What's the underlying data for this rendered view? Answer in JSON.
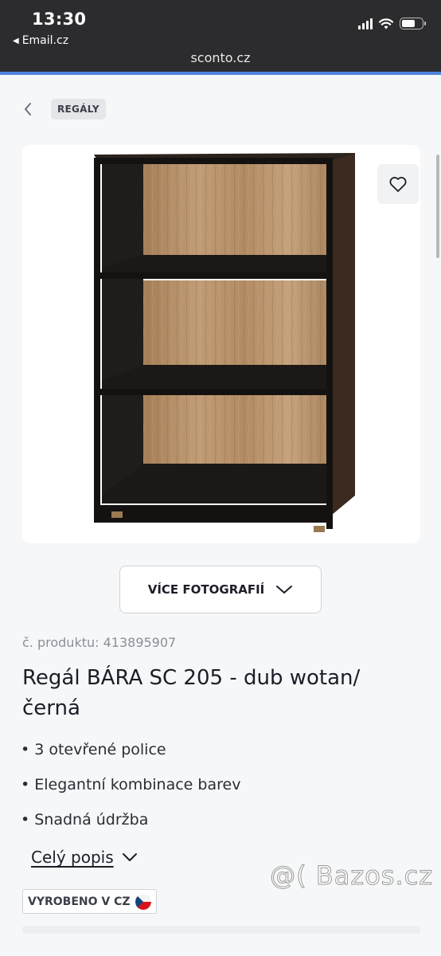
{
  "status_bar": {
    "time": "13:30",
    "back_app": "Email.cz"
  },
  "browser": {
    "url": "sconto.cz"
  },
  "breadcrumb": {
    "category": "REGÁLY"
  },
  "product": {
    "more_photos_label": "VÍCE FOTOGRAFIÍ",
    "sku": "č. produktu: 413895907",
    "title": "Regál BÁRA SC 205 - dub wotan/ černá",
    "features": [
      "3 otevřené police",
      "Elegantní kombinace barev",
      "Snadná údržba"
    ],
    "full_description_link": "Celý popis",
    "made_in_badge": "VYROBENO V CZ"
  },
  "watermark": "@( Bazos.cz",
  "colors": {
    "accent_line": "#2e6fd8",
    "wood": "#b38d66",
    "dark_frame": "#1c1a18",
    "text": "#1d1d28",
    "muted": "#8a8f98"
  },
  "icons": [
    "signal-icon",
    "wifi-icon",
    "battery-icon",
    "chevron-left-icon",
    "heart-icon",
    "chevron-down-icon",
    "czech-flag-icon"
  ]
}
